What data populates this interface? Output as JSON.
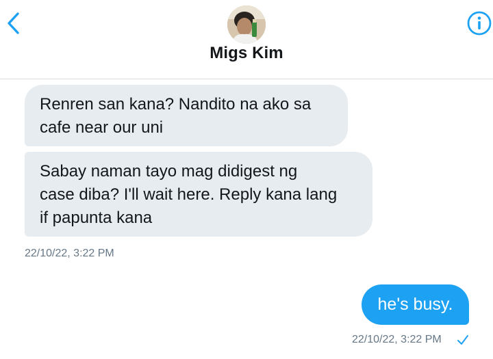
{
  "header": {
    "contact_name": "Migs Kim",
    "back_icon": "chevron-left-icon",
    "info_icon": "info-circle-icon",
    "accent_color": "#1da1f2"
  },
  "messages": [
    {
      "direction": "incoming",
      "text": "Renren san kana? Nandito na ako sa\ncafe near our uni"
    },
    {
      "direction": "incoming",
      "text": "Sabay naman tayo mag didigest ng\ncase diba? I'll wait here. Reply kana lang\nif papunta kana"
    },
    {
      "direction": "outgoing",
      "text": "he's busy."
    }
  ],
  "timestamps": {
    "incoming": "22/10/22, 3:22 PM",
    "outgoing": "22/10/22, 3:22 PM"
  },
  "status": {
    "read_icon": "checkmark-icon"
  },
  "colors": {
    "incoming_bubble": "#e6ecf0",
    "outgoing_bubble": "#1da1f2",
    "timestamp": "#657786"
  }
}
